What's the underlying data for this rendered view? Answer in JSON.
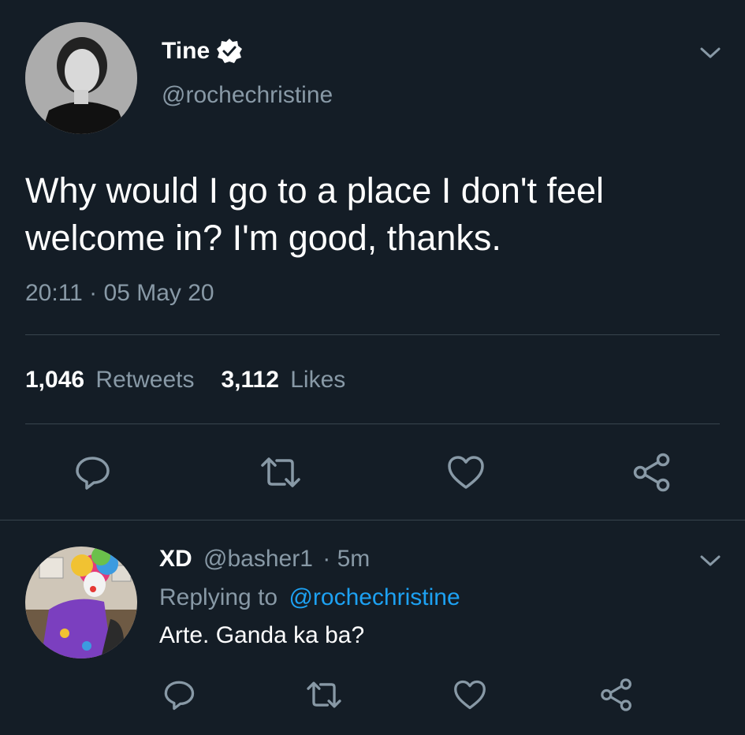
{
  "tweet": {
    "author_name": "Tine",
    "author_handle": "@rochechristine",
    "text_line1": "Why would I go to a place I don't feel",
    "text_line2": "welcome in? I'm good, thanks.",
    "timestamp": "20:11 · 05 May 20",
    "retweets_count": "1,046",
    "retweets_label": "Retweets",
    "likes_count": "3,112",
    "likes_label": "Likes",
    "verified": true
  },
  "reply": {
    "author_name": "XD",
    "author_handle": "@basher1",
    "time": "· 5m",
    "replying_prefix": "Replying to",
    "replying_handle": "@rochechristine",
    "text": "Arte. Ganda ka ba?"
  },
  "icons": [
    "reply-icon",
    "retweet-icon",
    "like-icon",
    "share-icon",
    "chevron-down-icon",
    "verified-badge-icon"
  ],
  "colors": {
    "background": "#141d26",
    "text": "#ffffff",
    "muted": "#8899a6",
    "link": "#1da1f2",
    "divider": "#38444d"
  }
}
